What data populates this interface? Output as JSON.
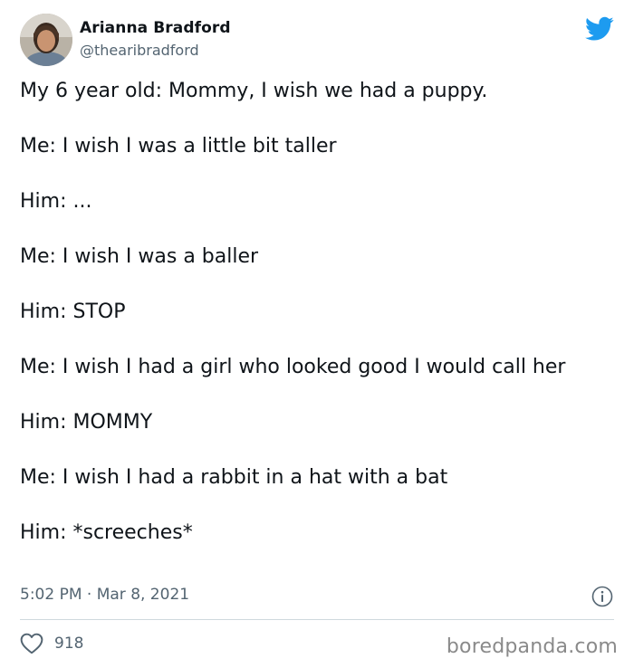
{
  "author": {
    "name": "Arianna Bradford",
    "handle": "@thearibradford",
    "avatar_icon": "profile-photo"
  },
  "platform_icon": "twitter-bird-icon",
  "colors": {
    "brand": "#1d9bf0",
    "text": "#0f1419",
    "secondary": "#536471",
    "divider": "#cfd9de"
  },
  "tweet": {
    "lines": [
      "My 6 year old: Mommy, I wish we had a puppy.",
      "Me: I wish I was a little bit taller",
      "Him: ...",
      "Me: I wish I was a baller",
      "Him: STOP",
      "Me: I wish I had a girl who looked good I would call her",
      "Him: MOMMY",
      "Me: I wish I had a rabbit in a hat with a bat",
      "Him: *screeches*"
    ],
    "timestamp": "5:02 PM · Mar 8, 2021"
  },
  "actions": {
    "like_count": "918"
  },
  "watermark": "boredpanda.com"
}
